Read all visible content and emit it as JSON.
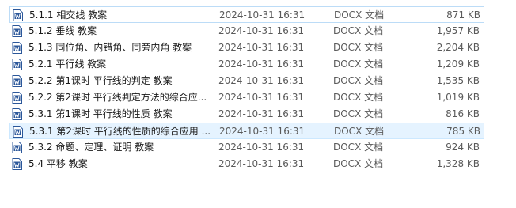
{
  "files": [
    {
      "name": "5.1.1 相交线 教案",
      "date": "2024-10-31 16:31",
      "type": "DOCX 文档",
      "size": "871 KB",
      "icon": "word-doc-icon"
    },
    {
      "name": "5.1.2 垂线 教案",
      "date": "2024-10-31 16:31",
      "type": "DOCX 文档",
      "size": "1,957 KB",
      "icon": "word-doc-icon"
    },
    {
      "name": "5.1.3 同位角、内错角、同旁内角 教案",
      "date": "2024-10-31 16:31",
      "type": "DOCX 文档",
      "size": "2,204 KB",
      "icon": "word-doc-icon"
    },
    {
      "name": "5.2.1 平行线 教案",
      "date": "2024-10-31 16:31",
      "type": "DOCX 文档",
      "size": "1,209 KB",
      "icon": "word-doc-icon"
    },
    {
      "name": "5.2.2 第1课时 平行线的判定 教案",
      "date": "2024-10-31 16:31",
      "type": "DOCX 文档",
      "size": "1,535 KB",
      "icon": "word-doc-icon"
    },
    {
      "name": "5.2.2 第2课时 平行线判定方法的综合应...",
      "date": "2024-10-31 16:31",
      "type": "DOCX 文档",
      "size": "1,019 KB",
      "icon": "word-doc-icon"
    },
    {
      "name": "5.3.1 第1课时 平行线的性质 教案",
      "date": "2024-10-31 16:31",
      "type": "DOCX 文档",
      "size": "816 KB",
      "icon": "word-doc-icon"
    },
    {
      "name": "5.3.1 第2课时 平行线的性质的综合应用 ...",
      "date": "2024-10-31 16:31",
      "type": "DOCX 文档",
      "size": "785 KB",
      "icon": "word-doc-icon"
    },
    {
      "name": "5.3.2 命题、定理、证明 教案",
      "date": "2024-10-31 16:31",
      "type": "DOCX 文档",
      "size": "924 KB",
      "icon": "word-doc-icon"
    },
    {
      "name": "5.4 平移 教案",
      "date": "2024-10-31 16:31",
      "type": "DOCX 文档",
      "size": "1,328 KB",
      "icon": "word-doc-icon"
    }
  ],
  "colors": {
    "selection_background": "#e5f3ff",
    "selection_border": "#cce8ff",
    "word_icon_blue": "#2b579a"
  }
}
